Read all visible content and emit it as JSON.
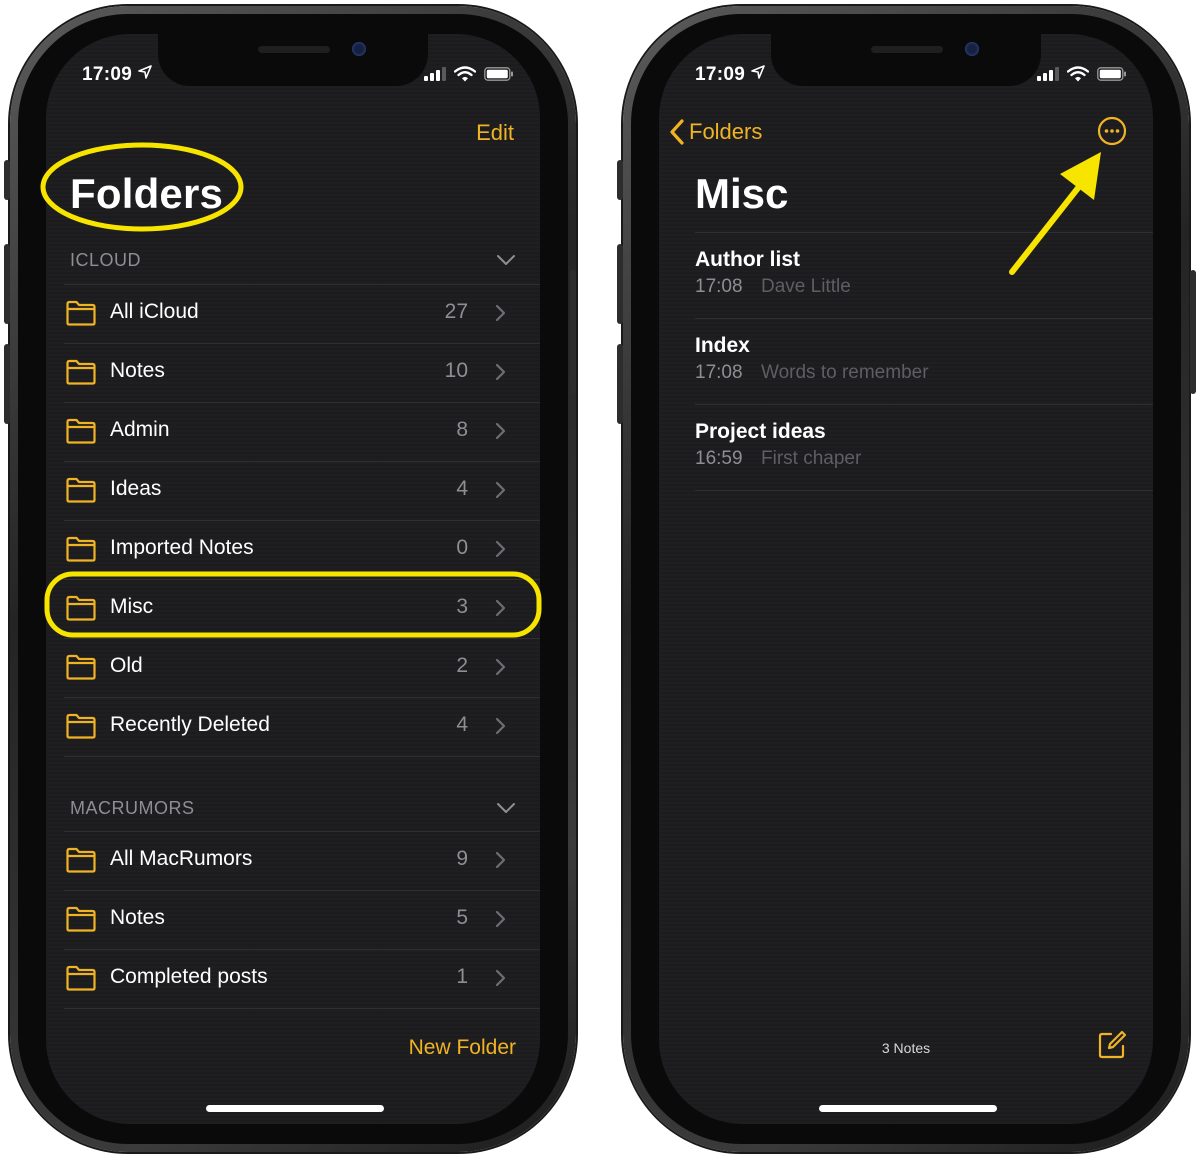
{
  "colors": {
    "accent": "#f0b324",
    "background": "#1c1c1e",
    "highlight": "#f7e500"
  },
  "status": {
    "time": "17:09"
  },
  "left": {
    "edit_label": "Edit",
    "title": "Folders",
    "sections": [
      {
        "header": "ICLOUD",
        "folders": [
          {
            "name": "All iCloud",
            "count": "27"
          },
          {
            "name": "Notes",
            "count": "10"
          },
          {
            "name": "Admin",
            "count": "8"
          },
          {
            "name": "Ideas",
            "count": "4"
          },
          {
            "name": "Imported Notes",
            "count": "0"
          },
          {
            "name": "Misc",
            "count": "3"
          },
          {
            "name": "Old",
            "count": "2"
          },
          {
            "name": "Recently Deleted",
            "count": "4"
          }
        ]
      },
      {
        "header": "MACRUMORS",
        "folders": [
          {
            "name": "All MacRumors",
            "count": "9"
          },
          {
            "name": "Notes",
            "count": "5"
          },
          {
            "name": "Completed posts",
            "count": "1"
          }
        ]
      }
    ],
    "new_folder_label": "New Folder"
  },
  "right": {
    "back_label": "Folders",
    "title": "Misc",
    "notes": [
      {
        "title": "Author list",
        "time": "17:08",
        "preview": "Dave Little"
      },
      {
        "title": "Index",
        "time": "17:08",
        "preview": "Words to remember"
      },
      {
        "title": "Project ideas",
        "time": "16:59",
        "preview": "First chaper"
      }
    ],
    "footer_count": "3 Notes",
    "icons": {
      "more": "ellipsis-circle-icon",
      "compose": "compose-icon",
      "back": "chevron-left-icon"
    }
  }
}
